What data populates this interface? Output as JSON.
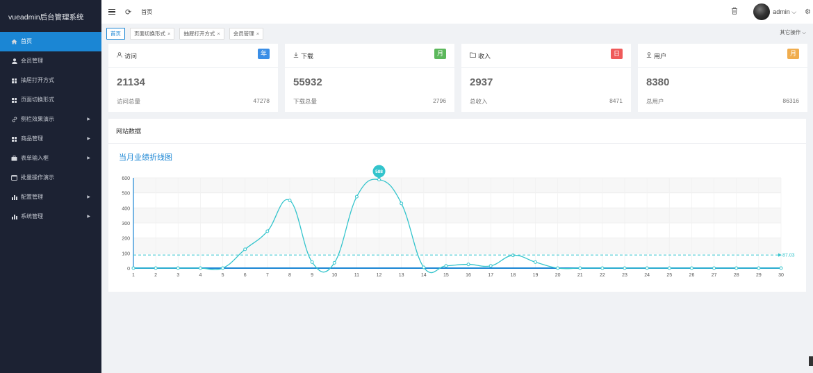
{
  "app": {
    "title": "vueadmin后台管理系统"
  },
  "sidebar": {
    "items": [
      {
        "label": "首页",
        "icon": "home-icon",
        "active": true,
        "expandable": false
      },
      {
        "label": "会员管理",
        "icon": "user-icon",
        "active": false,
        "expandable": false
      },
      {
        "label": "抽屉打开方式",
        "icon": "grid-icon",
        "active": false,
        "expandable": false
      },
      {
        "label": "页面切换形式",
        "icon": "grid-icon",
        "active": false,
        "expandable": false
      },
      {
        "label": "侧栏效果演示",
        "icon": "link-icon",
        "active": false,
        "expandable": true
      },
      {
        "label": "商品管理",
        "icon": "grid-icon",
        "active": false,
        "expandable": true
      },
      {
        "label": "表单输入框",
        "icon": "briefcase-icon",
        "active": false,
        "expandable": true
      },
      {
        "label": "批量操作演示",
        "icon": "window-icon",
        "active": false,
        "expandable": false
      },
      {
        "label": "配置管理",
        "icon": "bar-chart-icon",
        "active": false,
        "expandable": true
      },
      {
        "label": "系统管理",
        "icon": "bar-chart-icon",
        "active": false,
        "expandable": true
      }
    ]
  },
  "header": {
    "breadcrumb": "首页",
    "username": "admin"
  },
  "tabs": {
    "items": [
      {
        "label": "首页",
        "closable": false,
        "active": true
      },
      {
        "label": "页面切换形式",
        "closable": true,
        "active": false
      },
      {
        "label": "抽屉打开方式",
        "closable": true,
        "active": false
      },
      {
        "label": "会员管理",
        "closable": true,
        "active": false
      }
    ],
    "other_ops": "其它操作"
  },
  "cards": [
    {
      "title": "访问",
      "icon": "user-outline-icon",
      "badge": "年",
      "badge_color": "#3a8ee6",
      "value": "21134",
      "foot_label": "访问总量",
      "foot_value": "47278"
    },
    {
      "title": "下载",
      "icon": "download-icon",
      "badge": "月",
      "badge_color": "#5cb85c",
      "value": "55932",
      "foot_label": "下载总量",
      "foot_value": "2796"
    },
    {
      "title": "收入",
      "icon": "folder-icon",
      "badge": "日",
      "badge_color": "#ef5a5a",
      "value": "2937",
      "foot_label": "总收入",
      "foot_value": "8471"
    },
    {
      "title": "用户",
      "icon": "person-icon",
      "badge": "月",
      "badge_color": "#f0ad4e",
      "value": "8380",
      "foot_label": "总用户",
      "foot_value": "86316"
    }
  ],
  "panel": {
    "title": "网站数据"
  },
  "chart_data": {
    "type": "line",
    "title": "当月业绩折线图",
    "x": [
      1,
      2,
      3,
      4,
      5,
      6,
      7,
      8,
      9,
      10,
      11,
      12,
      13,
      14,
      15,
      16,
      17,
      18,
      19,
      20,
      21,
      22,
      23,
      24,
      25,
      26,
      27,
      28,
      29,
      30
    ],
    "series": [
      {
        "values": [
          0,
          0,
          0,
          0,
          0,
          125,
          245,
          450,
          40,
          35,
          475,
          588,
          430,
          5,
          15,
          25,
          15,
          85,
          40,
          0,
          0,
          0,
          0,
          0,
          0,
          0,
          0,
          0,
          0,
          0
        ]
      }
    ],
    "ylim": [
      0,
      600
    ],
    "yticks": [
      0,
      100,
      200,
      300,
      400,
      500,
      600
    ],
    "max_marker": {
      "x": 12,
      "label": "588"
    },
    "mean_line": {
      "label": "87.03",
      "value": 87.03
    },
    "colors": {
      "line": "#33c4cc",
      "title": "#1b86d4",
      "axis": "#1b86d4"
    }
  }
}
